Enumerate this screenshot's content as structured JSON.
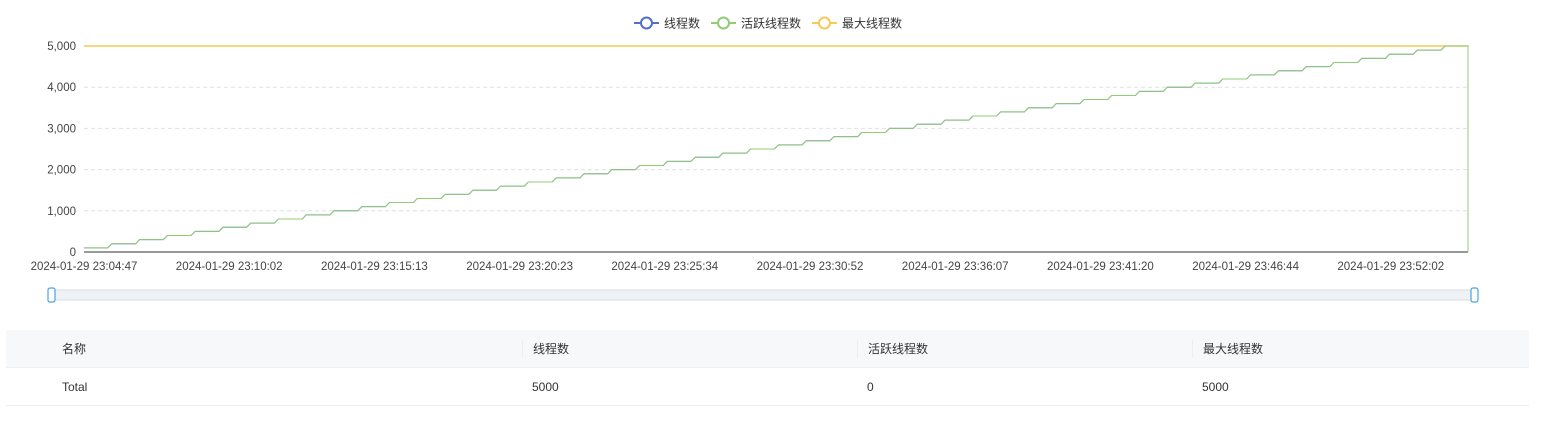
{
  "chart_data": {
    "type": "line",
    "legend_position": "top-center",
    "series": [
      {
        "name": "线程数",
        "color": "#5470c6"
      },
      {
        "name": "活跃线程数",
        "color": "#91cc75"
      },
      {
        "name": "最大线程数",
        "color": "#fac858"
      }
    ],
    "x_tick_labels": [
      "2024-01-29 23:04:47",
      "2024-01-29 23:10:02",
      "2024-01-29 23:15:13",
      "2024-01-29 23:20:23",
      "2024-01-29 23:25:34",
      "2024-01-29 23:30:52",
      "2024-01-29 23:36:07",
      "2024-01-29 23:41:20",
      "2024-01-29 23:46:44",
      "2024-01-29 23:52:02"
    ],
    "y_tick_labels": [
      "0",
      "1,000",
      "2,000",
      "3,000",
      "4,000",
      "5,000"
    ],
    "ylim": [
      0,
      5000
    ],
    "grid": true,
    "data_description_hint": "线程数 and 活跃线程数 rise in steps of 100 from 100 to 5000 over time; 最大线程数 constant at 5000; at the end 活跃线程数 drops to 0",
    "step_start": 100,
    "step_end": 5000,
    "step_size": 100,
    "max_value": 5000,
    "final_active": 0,
    "datazoom_range_percent": [
      0,
      100
    ]
  },
  "table": {
    "headers": [
      "名称",
      "线程数",
      "活跃线程数",
      "最大线程数"
    ],
    "rows": [
      [
        "Total",
        "5000",
        "0",
        "5000"
      ]
    ]
  }
}
